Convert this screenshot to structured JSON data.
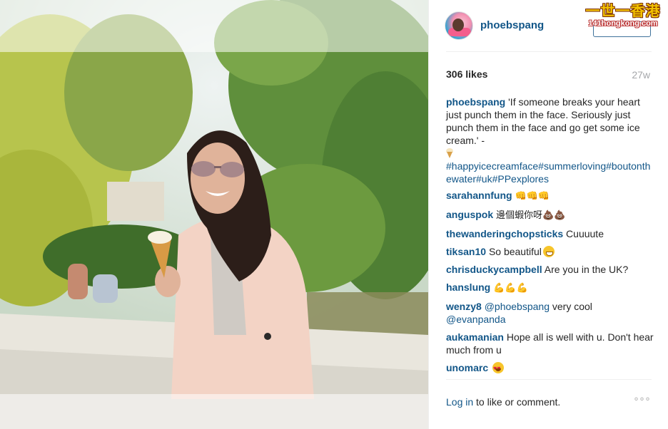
{
  "post": {
    "username": "phoebspang",
    "likes": "306 likes",
    "age": "27w",
    "caption": {
      "user": "phoebspang",
      "text": "'If someone breaks your heart just punch them in the face. Seriously just punch them in the face and go get some ice cream.' -",
      "icon": "ice-cream-icon",
      "hashtags": "#happyicecreamface#summerloving#boutonthewater#uk#PPexplores"
    }
  },
  "watermark": {
    "chinese": "一世一香港",
    "url": "141hongkong.com"
  },
  "comments": [
    {
      "user": "sarahannfung",
      "text": "",
      "emoji": "👊👊👊"
    },
    {
      "user": "anguspok",
      "text": "邊個蝦你呀",
      "emoji": "💩💩"
    },
    {
      "user": "thewanderingchopsticks",
      "text": "Cuuuute",
      "emoji": ""
    },
    {
      "user": "tiksan10",
      "text": "So beautiful",
      "emoji": "grinning-face-icon"
    },
    {
      "user": "chrisduckycampbell",
      "text": "Are you in the UK?",
      "emoji": ""
    },
    {
      "user": "hanslung",
      "text": "",
      "emoji": "💪💪💪"
    },
    {
      "user": "wenzy8",
      "mention": "@phoebspang",
      "text": "very cool",
      "mention2": "@evanpanda"
    },
    {
      "user": "aukamanian",
      "text": "Hope all is well with u. Don't hear much from u",
      "emoji": ""
    },
    {
      "user": "unomarc",
      "text": "",
      "emoji": "heart-eyes-face-icon"
    }
  ],
  "footer": {
    "login_link": "Log in",
    "login_rest": "to like or comment.",
    "more_icon": "°°°"
  },
  "colors": {
    "link": "#125688",
    "text": "#262626",
    "muted": "#a5a7aa"
  }
}
